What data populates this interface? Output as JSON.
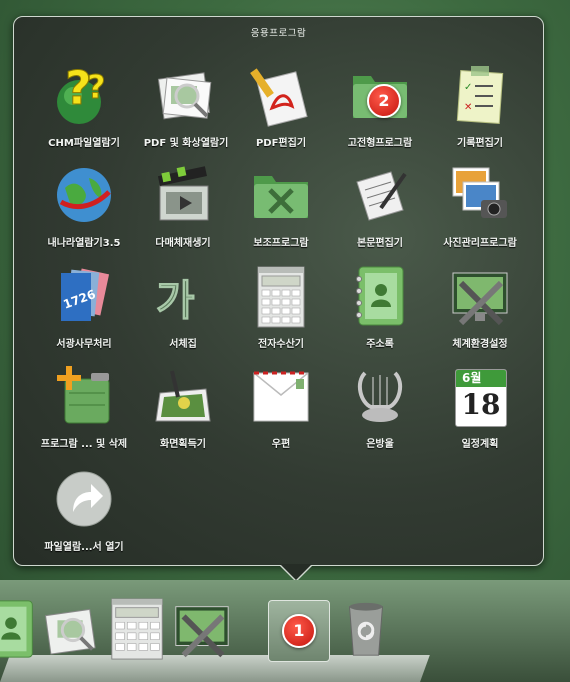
{
  "stack": {
    "title": "응용프로그람",
    "items": [
      {
        "label": "CHM파일열람기",
        "icon": "chm-help-icon"
      },
      {
        "label": "PDF 및 화상열람기",
        "icon": "pdf-viewer-icon"
      },
      {
        "label": "PDF편집기",
        "icon": "pdf-editor-icon"
      },
      {
        "label": "고전형프로그람",
        "icon": "folder-icon",
        "badge": "2"
      },
      {
        "label": "기록편집기",
        "icon": "notes-icon"
      },
      {
        "label": "내나라열람기3.5",
        "icon": "browser-globe-icon"
      },
      {
        "label": "다매체재생기",
        "icon": "media-player-icon"
      },
      {
        "label": "보조프로그람",
        "icon": "utilities-folder-icon"
      },
      {
        "label": "본문편집기",
        "icon": "text-editor-icon"
      },
      {
        "label": "사진관리프로그람",
        "icon": "photo-manager-icon"
      },
      {
        "label": "서광사무처리",
        "icon": "office-suite-icon"
      },
      {
        "label": "서체집",
        "icon": "font-book-icon"
      },
      {
        "label": "전자수산기",
        "icon": "calculator-icon"
      },
      {
        "label": "주소록",
        "icon": "address-book-icon"
      },
      {
        "label": "체계환경설정",
        "icon": "system-preferences-icon"
      },
      {
        "label": "프로그람 ... 및 삭제",
        "icon": "add-remove-programs-icon"
      },
      {
        "label": "화면획득기",
        "icon": "screenshot-icon"
      },
      {
        "label": "우편",
        "icon": "mail-envelope-icon"
      },
      {
        "label": "은방울",
        "icon": "music-lyre-icon"
      },
      {
        "label": "일정계획",
        "icon": "calendar-icon",
        "calendar_month": "6월",
        "calendar_day": "18"
      },
      {
        "label": "파일열람...서 열기",
        "icon": "open-in-finder-arrow-icon"
      }
    ]
  },
  "dock": {
    "items": [
      {
        "icon": "address-book-icon"
      },
      {
        "icon": "pdf-viewer-icon"
      },
      {
        "icon": "calculator-icon"
      },
      {
        "icon": "system-preferences-icon"
      },
      {
        "icon": "applications-stack-icon",
        "badge": "1"
      },
      {
        "icon": "trash-icon"
      }
    ]
  },
  "colors": {
    "badge": "#d21f14",
    "folder_green": "#6fb06a",
    "panel_border": "#cfd8cf"
  }
}
